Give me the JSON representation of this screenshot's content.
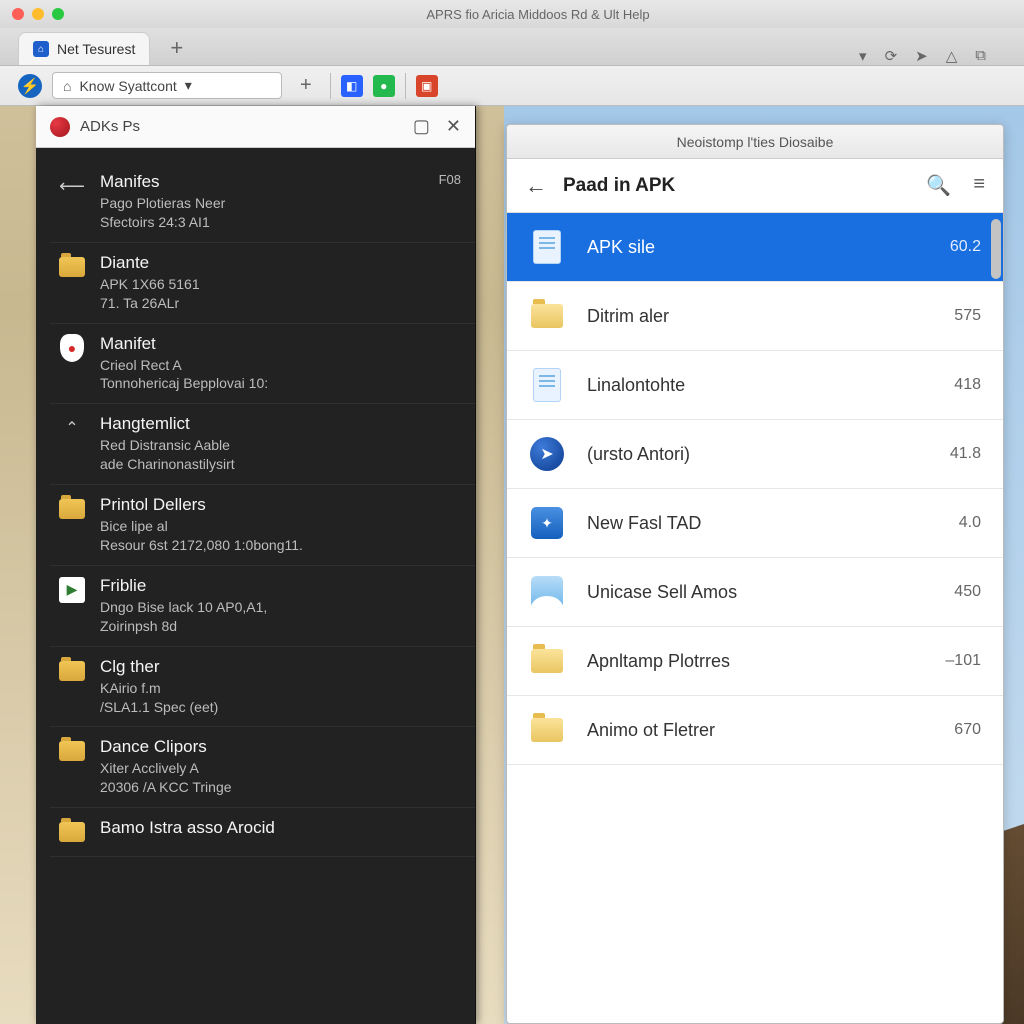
{
  "menubar": {
    "title": "APRS fio Aricia Middoos Rd & Ult Help"
  },
  "browser": {
    "tab_label": "Net Tesurest",
    "address_label": "Know Syattcont",
    "dropdown_glyph": "▾"
  },
  "left_panel": {
    "title": "ADKs Ps",
    "items": [
      {
        "icon": "back",
        "name": "Manifes",
        "sub1": "Pago Plotieras Neer",
        "sub2": "Sfectoirs  24:3  AI1",
        "meta": "F08"
      },
      {
        "icon": "folder",
        "name": "Diante",
        "sub1": "APK 1X66 5161",
        "sub2": "71. Ta  26ALr",
        "meta": ""
      },
      {
        "icon": "pin",
        "name": "Manifet",
        "sub1": "Crieol Rect A",
        "sub2": "Tonnohericaj Bepplovai 10:",
        "meta": ""
      },
      {
        "icon": "chev",
        "name": "Hangtemlict",
        "sub1": "Red Distransic Aable",
        "sub2": "ade Charinonastilysirt",
        "meta": ""
      },
      {
        "icon": "folder",
        "name": "Printol Dellers",
        "sub1": "Bice lipe al",
        "sub2": "Resour 6st 2172,080 1:0bong11.",
        "meta": ""
      },
      {
        "icon": "play",
        "name": "Friblie",
        "sub1": "Dngo Bise lack 10 AP0,A1,",
        "sub2": "Zoirinpsh 8d",
        "meta": ""
      },
      {
        "icon": "folder",
        "name": "Clg ther",
        "sub1": "KAirio f.m",
        "sub2": "/SLA1.1 Spec (eet)",
        "meta": ""
      },
      {
        "icon": "folder",
        "name": "Dance Clipors",
        "sub1": "Xiter Acclively A",
        "sub2": "20306 /A KCC Tringe",
        "meta": ""
      },
      {
        "icon": "folder",
        "name": "Bamo Istra asso Arocid",
        "sub1": "",
        "sub2": "",
        "meta": ""
      }
    ]
  },
  "right_panel": {
    "window_title": "Neoistomp l'ties Diosaibe",
    "path_label": "Paad in APK",
    "rows": [
      {
        "icon": "doc",
        "name": "APK sile",
        "size": "60.2",
        "selected": true
      },
      {
        "icon": "folder",
        "name": "Ditrim aler",
        "size": "575",
        "selected": false
      },
      {
        "icon": "doc",
        "name": "Linalontohte",
        "size": "418",
        "selected": false
      },
      {
        "icon": "circle",
        "name": "(ursto Antori)",
        "size": "41.8",
        "selected": false
      },
      {
        "icon": "app",
        "name": "New Fasl TAD",
        "size": "4.0",
        "selected": false
      },
      {
        "icon": "pic",
        "name": "Unicase Sell Amos",
        "size": "450",
        "selected": false
      },
      {
        "icon": "folder",
        "name": "Apnltamp Plotrres",
        "size": "–101",
        "selected": false
      },
      {
        "icon": "folder",
        "name": "Animo ot Fletrer",
        "size": "670",
        "selected": false
      }
    ]
  }
}
